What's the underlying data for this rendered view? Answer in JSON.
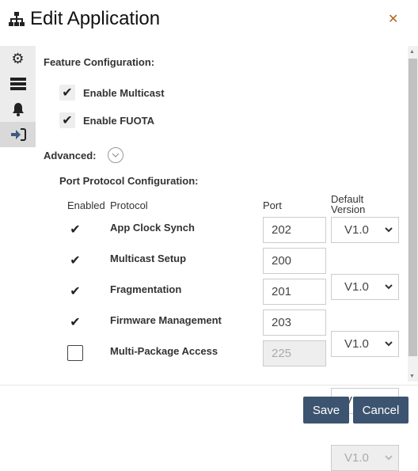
{
  "dialog": {
    "title": "Edit Application",
    "title_icon": "sitemap-icon",
    "close_icon": "close-icon"
  },
  "sidebar": {
    "items": [
      {
        "icon": "gear-icon"
      },
      {
        "icon": "server-icon"
      },
      {
        "icon": "bell-icon"
      },
      {
        "icon": "sign-in-icon",
        "active": true
      }
    ]
  },
  "feature": {
    "heading": "Feature Configuration:",
    "options": [
      {
        "label": "Enable Multicast",
        "checked": true
      },
      {
        "label": "Enable FUOTA",
        "checked": true
      }
    ]
  },
  "advanced": {
    "label": "Advanced:"
  },
  "ports": {
    "heading": "Port Protocol Configuration:",
    "columns": {
      "enabled": "Enabled",
      "protocol": "Protocol",
      "port": "Port",
      "version": "Default Version"
    },
    "rows": [
      {
        "protocol": "App Clock Synch",
        "enabled": true,
        "port": "202",
        "version": "V1.0"
      },
      {
        "protocol": "Multicast Setup",
        "enabled": true,
        "port": "200",
        "version": "V1.0"
      },
      {
        "protocol": "Fragmentation",
        "enabled": true,
        "port": "201",
        "version": "V1.0"
      },
      {
        "protocol": "Firmware Management",
        "enabled": true,
        "port": "203",
        "version": "V1.0"
      },
      {
        "protocol": "Multi-Package Access",
        "enabled": false,
        "port": "225",
        "version": "V1.0"
      }
    ]
  },
  "footer": {
    "save": "Save",
    "cancel": "Cancel"
  },
  "colors": {
    "button": "#3d5470",
    "close": "#b5651d"
  }
}
